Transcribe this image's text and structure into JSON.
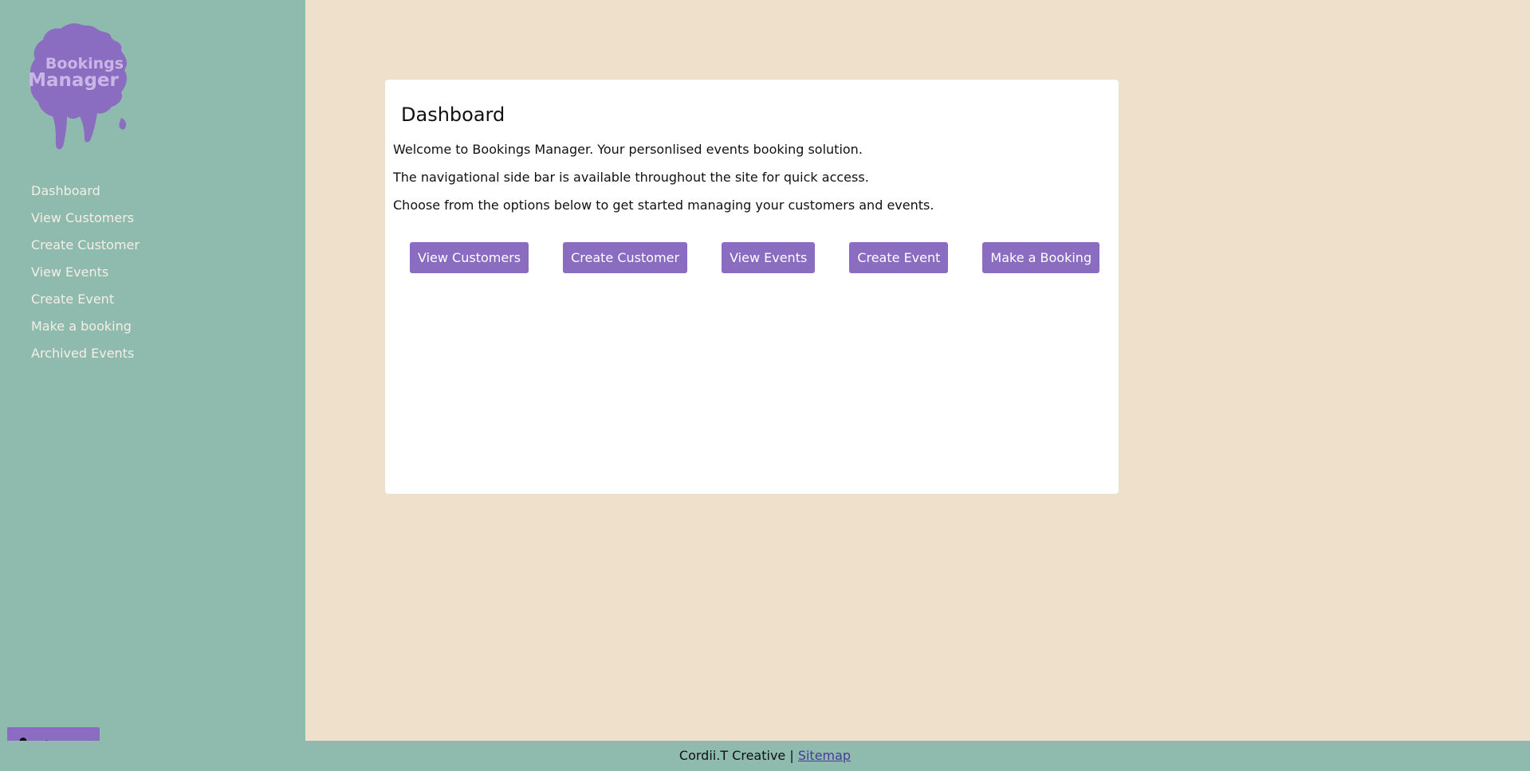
{
  "brand": {
    "logo_line1": "Bookings",
    "logo_line2": "Manager",
    "logo_color": "#8a6cc0"
  },
  "sidebar": {
    "items": [
      {
        "label": "Dashboard"
      },
      {
        "label": "View Customers"
      },
      {
        "label": "Create Customer"
      },
      {
        "label": "View Events"
      },
      {
        "label": "Create Event"
      },
      {
        "label": "Make a booking"
      },
      {
        "label": "Archived Events"
      }
    ],
    "account": {
      "label": "Account",
      "icon": "person-icon"
    }
  },
  "main": {
    "title": "Dashboard",
    "paragraphs": [
      "Welcome to Bookings Manager. Your personlised events booking solution.",
      "The navigational side bar is available throughout the site for quick access.",
      "Choose from the options below to get started managing your customers and events."
    ],
    "buttons": [
      {
        "label": "View Customers"
      },
      {
        "label": "Create Customer"
      },
      {
        "label": "View Events"
      },
      {
        "label": "Create Event"
      },
      {
        "label": "Make a Booking"
      }
    ]
  },
  "footer": {
    "text": "Cordii.T Creative | ",
    "link": "Sitemap"
  },
  "colors": {
    "sidebar_bg": "#8fbaae",
    "page_bg": "#efe0cc",
    "accent": "#8a6cc0",
    "card_bg": "#ffffff"
  }
}
